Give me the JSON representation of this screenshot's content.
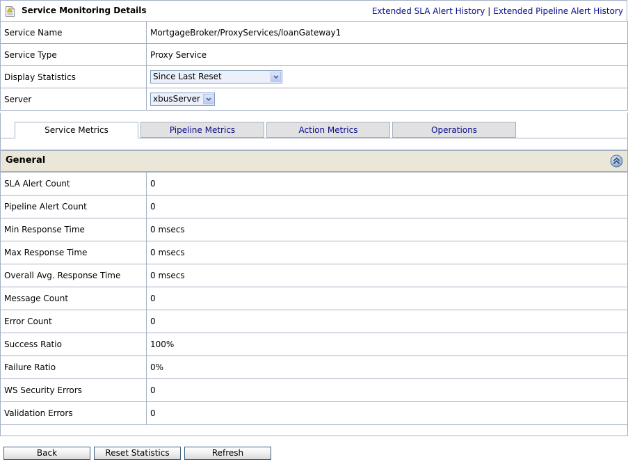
{
  "header": {
    "title": "Service Monitoring Details",
    "links": [
      {
        "label": "Extended SLA Alert History"
      },
      {
        "label": "Extended Pipeline Alert History"
      }
    ],
    "link_separator": "|"
  },
  "info": {
    "service_name": {
      "label": "Service Name",
      "value": "MortgageBroker/ProxyServices/loanGateway1"
    },
    "service_type": {
      "label": "Service Type",
      "value": "Proxy Service"
    },
    "display_statistics": {
      "label": "Display Statistics",
      "selected": "Since Last Reset"
    },
    "server": {
      "label": "Server",
      "selected": "xbusServer"
    }
  },
  "tabs": [
    {
      "label": "Service Metrics",
      "active": true
    },
    {
      "label": "Pipeline Metrics",
      "active": false
    },
    {
      "label": "Action Metrics",
      "active": false
    },
    {
      "label": "Operations",
      "active": false
    }
  ],
  "section": {
    "title": "General",
    "collapse_icon": "double-chevron-up-icon"
  },
  "metrics": [
    {
      "label": "SLA Alert Count",
      "value": "0"
    },
    {
      "label": "Pipeline Alert Count",
      "value": "0"
    },
    {
      "label": "Min Response Time",
      "value": "0 msecs"
    },
    {
      "label": "Max Response Time",
      "value": "0 msecs"
    },
    {
      "label": "Overall Avg. Response Time",
      "value": "0 msecs"
    },
    {
      "label": "Message Count",
      "value": "0"
    },
    {
      "label": "Error Count",
      "value": "0"
    },
    {
      "label": "Success Ratio",
      "value": "100%"
    },
    {
      "label": "Failure Ratio",
      "value": "0%"
    },
    {
      "label": "WS Security Errors",
      "value": "0"
    },
    {
      "label": "Validation Errors",
      "value": "0"
    }
  ],
  "buttons": {
    "back": "Back",
    "reset_statistics": "Reset Statistics",
    "refresh": "Refresh"
  },
  "colors": {
    "border": "#a4b0c4",
    "link": "#0b0b8c",
    "section_header_bg": "#ebe7d8",
    "inactive_tab_bg": "#e1e1e1"
  }
}
